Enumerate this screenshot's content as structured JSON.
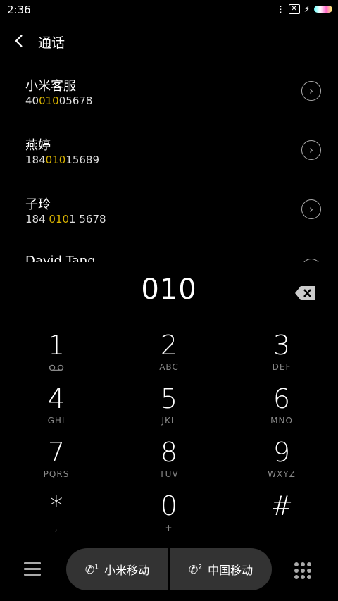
{
  "status": {
    "time": "2:36"
  },
  "header": {
    "title": "通话"
  },
  "contacts": [
    {
      "name": "小米客服",
      "number_pre": "40",
      "number_hl": "010",
      "number_post": "05678"
    },
    {
      "name": "燕婷",
      "number_pre": "184",
      "number_hl": "010",
      "number_post": "15689"
    },
    {
      "name": "子玲",
      "number_pre": "184 ",
      "number_hl": "010",
      "number_post": "1 5678"
    },
    {
      "name": "David Tang",
      "number_pre": "",
      "number_hl": "",
      "number_post": ""
    }
  ],
  "dial_input": "010",
  "keypad": [
    {
      "digit": "1",
      "letters": "voicemail-icon"
    },
    {
      "digit": "2",
      "letters": "ABC"
    },
    {
      "digit": "3",
      "letters": "DEF"
    },
    {
      "digit": "4",
      "letters": "GHI"
    },
    {
      "digit": "5",
      "letters": "JKL"
    },
    {
      "digit": "6",
      "letters": "MNO"
    },
    {
      "digit": "7",
      "letters": "PQRS"
    },
    {
      "digit": "8",
      "letters": "TUV"
    },
    {
      "digit": "9",
      "letters": "WXYZ"
    },
    {
      "digit": "*",
      "letters": ","
    },
    {
      "digit": "0",
      "letters": "+"
    },
    {
      "digit": "#",
      "letters": ""
    }
  ],
  "sim1": {
    "label": "小米移动",
    "index": "1"
  },
  "sim2": {
    "label": "中国移动",
    "index": "2"
  },
  "colors": {
    "highlight": "#d9b300",
    "background": "#000000",
    "sim_bar": "#333333"
  }
}
